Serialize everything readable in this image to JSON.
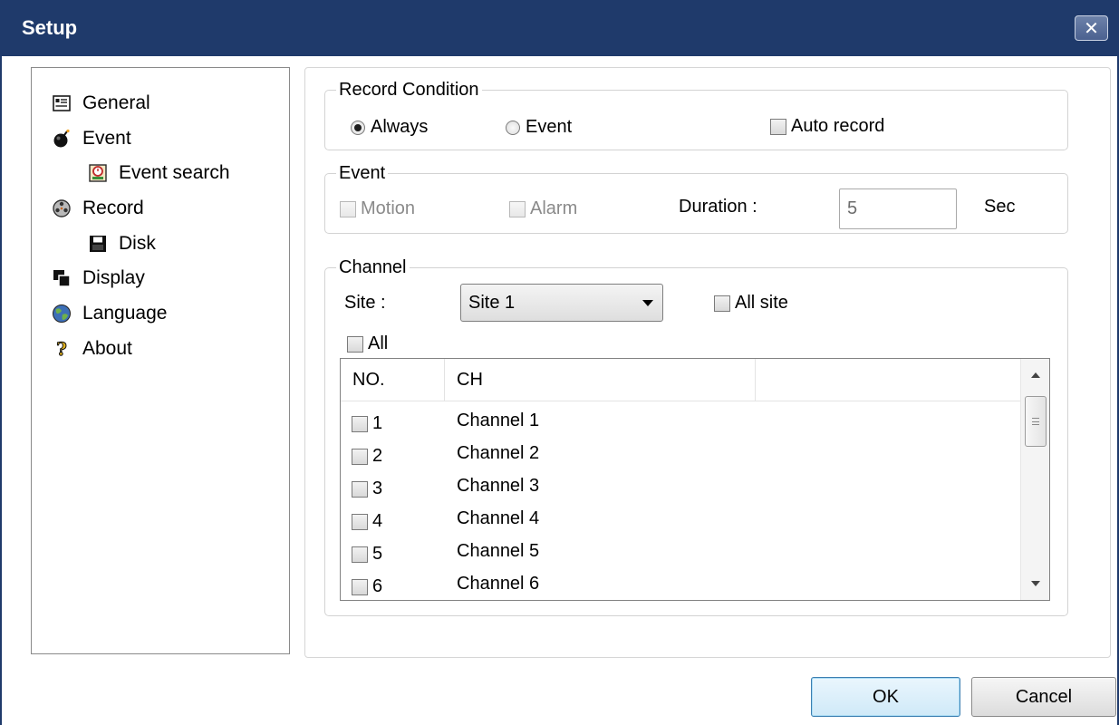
{
  "window": {
    "title": "Setup",
    "close_symbol": "✕"
  },
  "nav": {
    "items": [
      {
        "label": "General",
        "icon": "general-icon"
      },
      {
        "label": "Event",
        "icon": "bomb-icon"
      },
      {
        "label": "Event search",
        "icon": "event-search-icon"
      },
      {
        "label": "Record",
        "icon": "film-reel-icon"
      },
      {
        "label": "Disk",
        "icon": "floppy-disk-icon"
      },
      {
        "label": "Display",
        "icon": "display-icon"
      },
      {
        "label": "Language",
        "icon": "globe-icon"
      },
      {
        "label": "About",
        "icon": "question-icon"
      }
    ]
  },
  "record_condition": {
    "legend": "Record Condition",
    "always_label": "Always",
    "event_label": "Event",
    "auto_record_label": "Auto record",
    "selected": "Always"
  },
  "event_group": {
    "legend": "Event",
    "motion_label": "Motion",
    "alarm_label": "Alarm",
    "duration_label": "Duration :",
    "duration_value": "5",
    "unit": "Sec"
  },
  "channel": {
    "legend": "Channel",
    "site_label": "Site :",
    "site_value": "Site 1",
    "all_site_label": "All site",
    "all_label": "All",
    "columns": [
      "NO.",
      "CH"
    ],
    "rows": [
      {
        "no": "1",
        "ch": "Channel 1"
      },
      {
        "no": "2",
        "ch": "Channel 2"
      },
      {
        "no": "3",
        "ch": "Channel 3"
      },
      {
        "no": "4",
        "ch": "Channel 4"
      },
      {
        "no": "5",
        "ch": "Channel 5"
      },
      {
        "no": "6",
        "ch": "Channel 6"
      }
    ]
  },
  "buttons": {
    "ok": "OK",
    "cancel": "Cancel"
  }
}
